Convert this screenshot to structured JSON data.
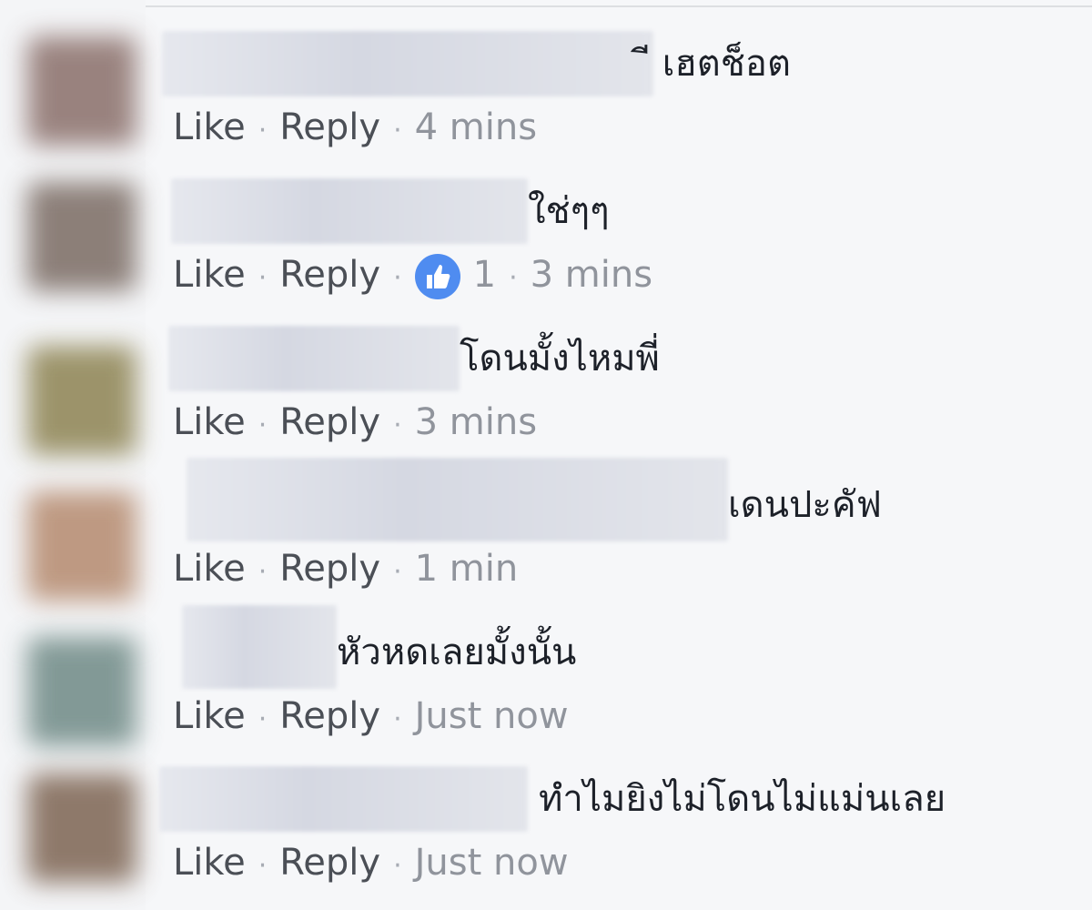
{
  "action_labels": {
    "like": "Like",
    "reply": "Reply",
    "separator": "·"
  },
  "colors": {
    "text": "#1d2129",
    "link": "#4b4f56",
    "meta": "#90949c",
    "like_badge": "#4f8cf0",
    "background": "#f6f7f9"
  },
  "comments": [
    {
      "text": "ี เฮตช็อต",
      "time": "4 mins"
    },
    {
      "text": "ใช่ๆๆ",
      "likes": "1",
      "time": "3 mins"
    },
    {
      "text": "โดนมั้งไหมพี่",
      "time": "3 mins"
    },
    {
      "text": "เดนปะคัฟ",
      "time": "1 min"
    },
    {
      "text": "หัวหดเลยมั้งนั้น",
      "time": "Just now"
    },
    {
      "text": "ทำไมยิงไม่โดนไม่แม่นเลย",
      "time": "Just now"
    }
  ],
  "icons": {
    "like_reaction": "thumbs-up-icon"
  }
}
